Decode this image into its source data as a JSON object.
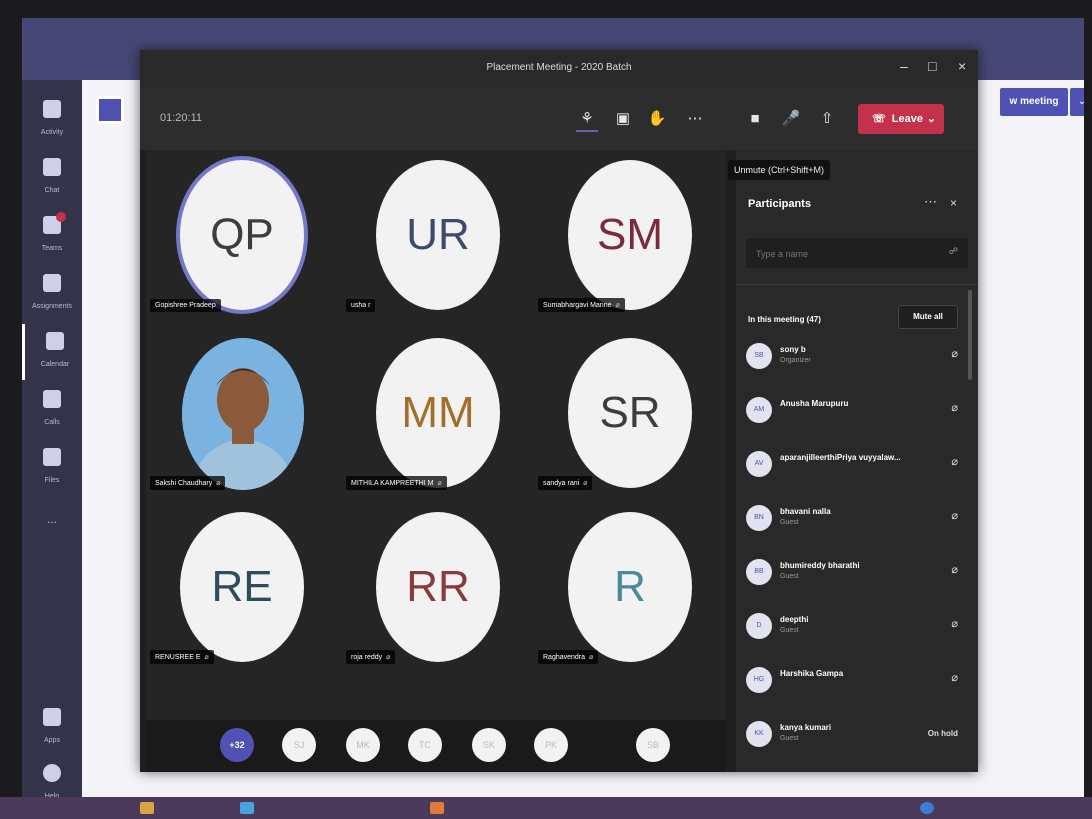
{
  "meeting": {
    "title": "Placement Meeting - 2020 Batch",
    "timer": "01:20:11",
    "leave_label": "Leave",
    "tooltip": "Unmute (Ctrl+Shift+M)"
  },
  "teams": {
    "new_meeting_label": "w meeting",
    "rail": [
      "Activity",
      "Chat",
      "Teams",
      "Assignments",
      "Calendar",
      "Calls",
      "Files",
      "...",
      "Apps",
      "Help"
    ]
  },
  "tiles": [
    {
      "initials": "QP",
      "name": "Gopishree Pradeep",
      "muted": false,
      "ring": true
    },
    {
      "initials": "UR",
      "name": "usha r",
      "muted": false
    },
    {
      "initials": "SM",
      "name": "Sumabhargavi Manne",
      "muted": true
    },
    {
      "photo": true,
      "name": "Sakshi Chaudhary",
      "muted": true
    },
    {
      "initials": "MM",
      "name": "MITHILA KAMPREETHI M",
      "muted": true
    },
    {
      "initials": "SR",
      "name": "sandya rani",
      "muted": true
    },
    {
      "initials": "RE",
      "name": "RENUSREE E",
      "muted": true
    },
    {
      "initials": "RR",
      "name": "roja reddy",
      "muted": true
    },
    {
      "initials": "R",
      "name": "Raghavendra",
      "muted": true
    }
  ],
  "strip": [
    "+32",
    "SJ",
    "MK",
    "TC",
    "SK",
    "PK",
    "SB"
  ],
  "participants": {
    "title": "Participants",
    "search_placeholder": "Type a name",
    "count_label": "In this meeting (47)",
    "mute_all": "Mute all",
    "list": [
      {
        "initials": "SB",
        "name": "sony b",
        "sub": "Organizer",
        "status": "🎤"
      },
      {
        "initials": "AM",
        "name": "Anusha Marupuru",
        "sub": "",
        "status": "🎤"
      },
      {
        "initials": "AV",
        "name": "aparanjilleerthiPriya vuyyalaw...",
        "sub": "",
        "status": "🎤"
      },
      {
        "initials": "BN",
        "name": "bhavani nalla",
        "sub": "Guest",
        "status": "🎤"
      },
      {
        "initials": "BB",
        "name": "bhumireddy bharathi",
        "sub": "Guest",
        "status": "🎤"
      },
      {
        "initials": "D",
        "name": "deepthi",
        "sub": "Guest",
        "status": "🎤"
      },
      {
        "initials": "HG",
        "name": "Harshika Gampa",
        "sub": "",
        "status": "🎤"
      },
      {
        "initials": "KK",
        "name": "kanya kumari",
        "sub": "Guest",
        "status": "On hold"
      }
    ]
  },
  "colors": {
    "accent": "#6264a7",
    "leave": "#c4314b",
    "panel": "#292929",
    "stage": "#252525"
  }
}
